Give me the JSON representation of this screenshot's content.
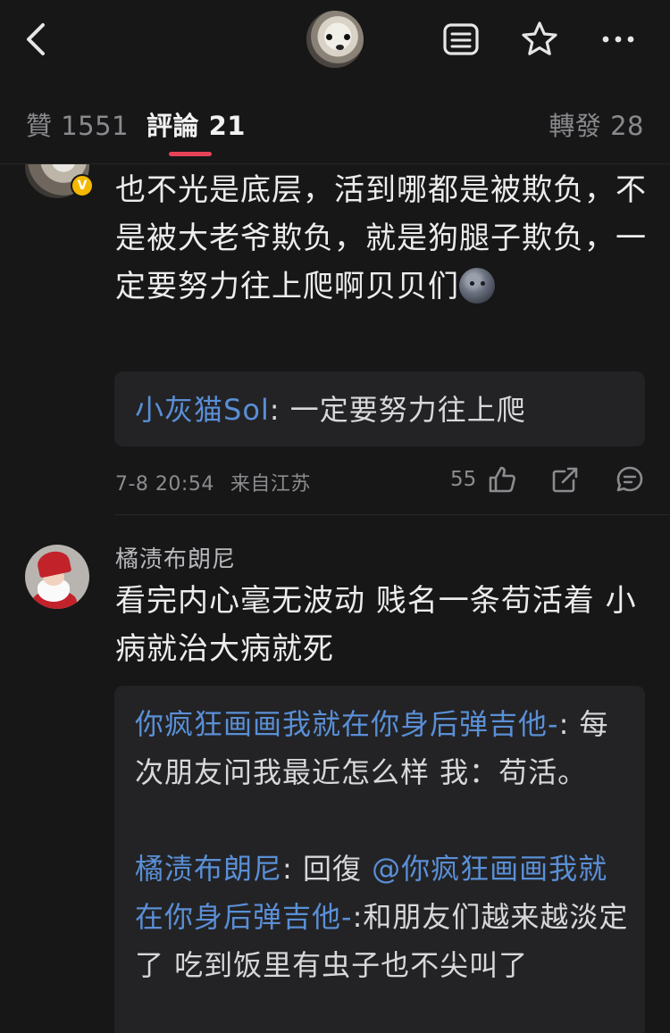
{
  "tabs": {
    "likes": "贊 1551",
    "comments": "評論 21",
    "reposts": "轉發 28"
  },
  "comments": [
    {
      "text": "也不光是底层，活到哪都是被欺负，不是被大老爷欺负，就是狗腿子欺负，一定要努力往上爬啊贝贝们",
      "verified_badge": "V",
      "reply": {
        "name": "小灰猫Sol",
        "sep": ": ",
        "text": "一定要努力往上爬"
      },
      "time": "7-8 20:54",
      "region": "来自江苏",
      "like_count": "55"
    },
    {
      "username": "橘渍布朗尼",
      "text": "看完内心毫无波动  贱名一条苟活着  小病就治大病就死",
      "replies": [
        {
          "name": "你疯狂画画我就在你身后弹吉他-",
          "sep": ": ",
          "text": "每次朋友问我最近怎么样 我：苟活。"
        },
        {
          "name": "橘渍布朗尼",
          "sep": ": 回復 ",
          "mention": "@你疯狂画画我就在你身后弹吉他-",
          "text": ":和朋友们越来越淡定了  吃到饭里有虫子也不尖叫了"
        }
      ]
    }
  ],
  "icons": {
    "back": "chevron-left-icon",
    "menu": "list-icon",
    "star": "star-icon",
    "more": "more-icon",
    "like": "thumbs-up-icon",
    "share": "share-icon",
    "reply": "comment-icon"
  },
  "colors": {
    "background": "#171718",
    "accent": "#e8425a",
    "link": "#5a8fd6",
    "reply_bg": "#232325"
  }
}
